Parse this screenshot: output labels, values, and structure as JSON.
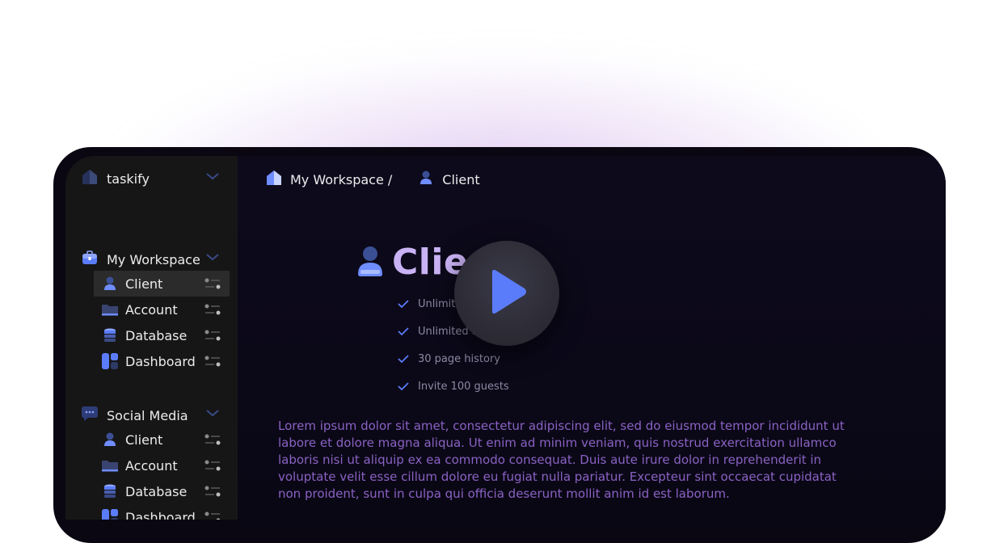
{
  "sidebar": {
    "brand": "taskify",
    "workspace": {
      "title": "My Workspace",
      "items": [
        {
          "label": "Client",
          "icon": "user-icon"
        },
        {
          "label": "Account",
          "icon": "folder-icon"
        },
        {
          "label": "Database",
          "icon": "database-icon"
        },
        {
          "label": "Dashboard",
          "icon": "dashboard-icon"
        }
      ]
    },
    "social": {
      "title": "Social Media",
      "items": [
        {
          "label": "Client",
          "icon": "user-icon"
        },
        {
          "label": "Account",
          "icon": "folder-icon"
        },
        {
          "label": "Database",
          "icon": "database-icon"
        },
        {
          "label": "Dashboard",
          "icon": "dashboard-icon"
        }
      ]
    }
  },
  "breadcrumb": {
    "workspace": "My Workspace /",
    "page": "Client"
  },
  "hero": {
    "title": "Clie",
    "features": [
      "Unlimite",
      "Unlimited fi",
      "30 page history",
      "Invite 100 guests"
    ],
    "description": "Lorem ipsum dolor sit amet, consectetur adipiscing elit, sed do eiusmod tempor incididunt ut labore et dolore magna aliqua. Ut enim ad minim veniam, quis nostrud exercitation ullamco laboris nisi ut aliquip ex ea commodo consequat. Duis aute irure dolor in reprehenderit in voluptate velit esse cillum dolore eu fugiat nulla pariatur. Excepteur sint occaecat cupidatat non proident, sunt in culpa qui officia deserunt mollit anim id est laborum."
  },
  "colors": {
    "accent": "#5b7cfa",
    "title": "#c9b3f5",
    "lorem": "#8a62c4"
  }
}
